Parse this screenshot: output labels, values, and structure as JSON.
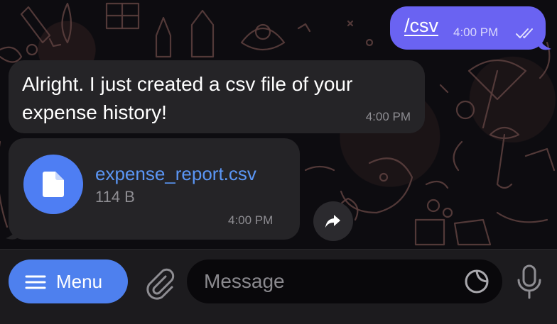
{
  "messages": {
    "outgoing": {
      "text": "/csv",
      "time": "4:00 PM",
      "status_icon": "double-check-icon"
    },
    "incoming_text": {
      "text": "Alright. I just created a csv file of your expense history!",
      "time": "4:00 PM"
    },
    "incoming_file": {
      "file_name": "expense_report.csv",
      "file_size": "114 B",
      "time": "4:00 PM",
      "icon": "document-icon",
      "share_icon": "share-arrow-icon"
    }
  },
  "input_bar": {
    "menu_label": "Menu",
    "message_placeholder": "Message",
    "attach_icon": "paperclip-icon",
    "sticker_icon": "sticker-icon",
    "mic_icon": "microphone-icon"
  },
  "colors": {
    "outgoing_bubble": "#6a63f2",
    "incoming_bubble": "#252427",
    "accent": "#4e80ee",
    "link": "#5b96f5"
  }
}
